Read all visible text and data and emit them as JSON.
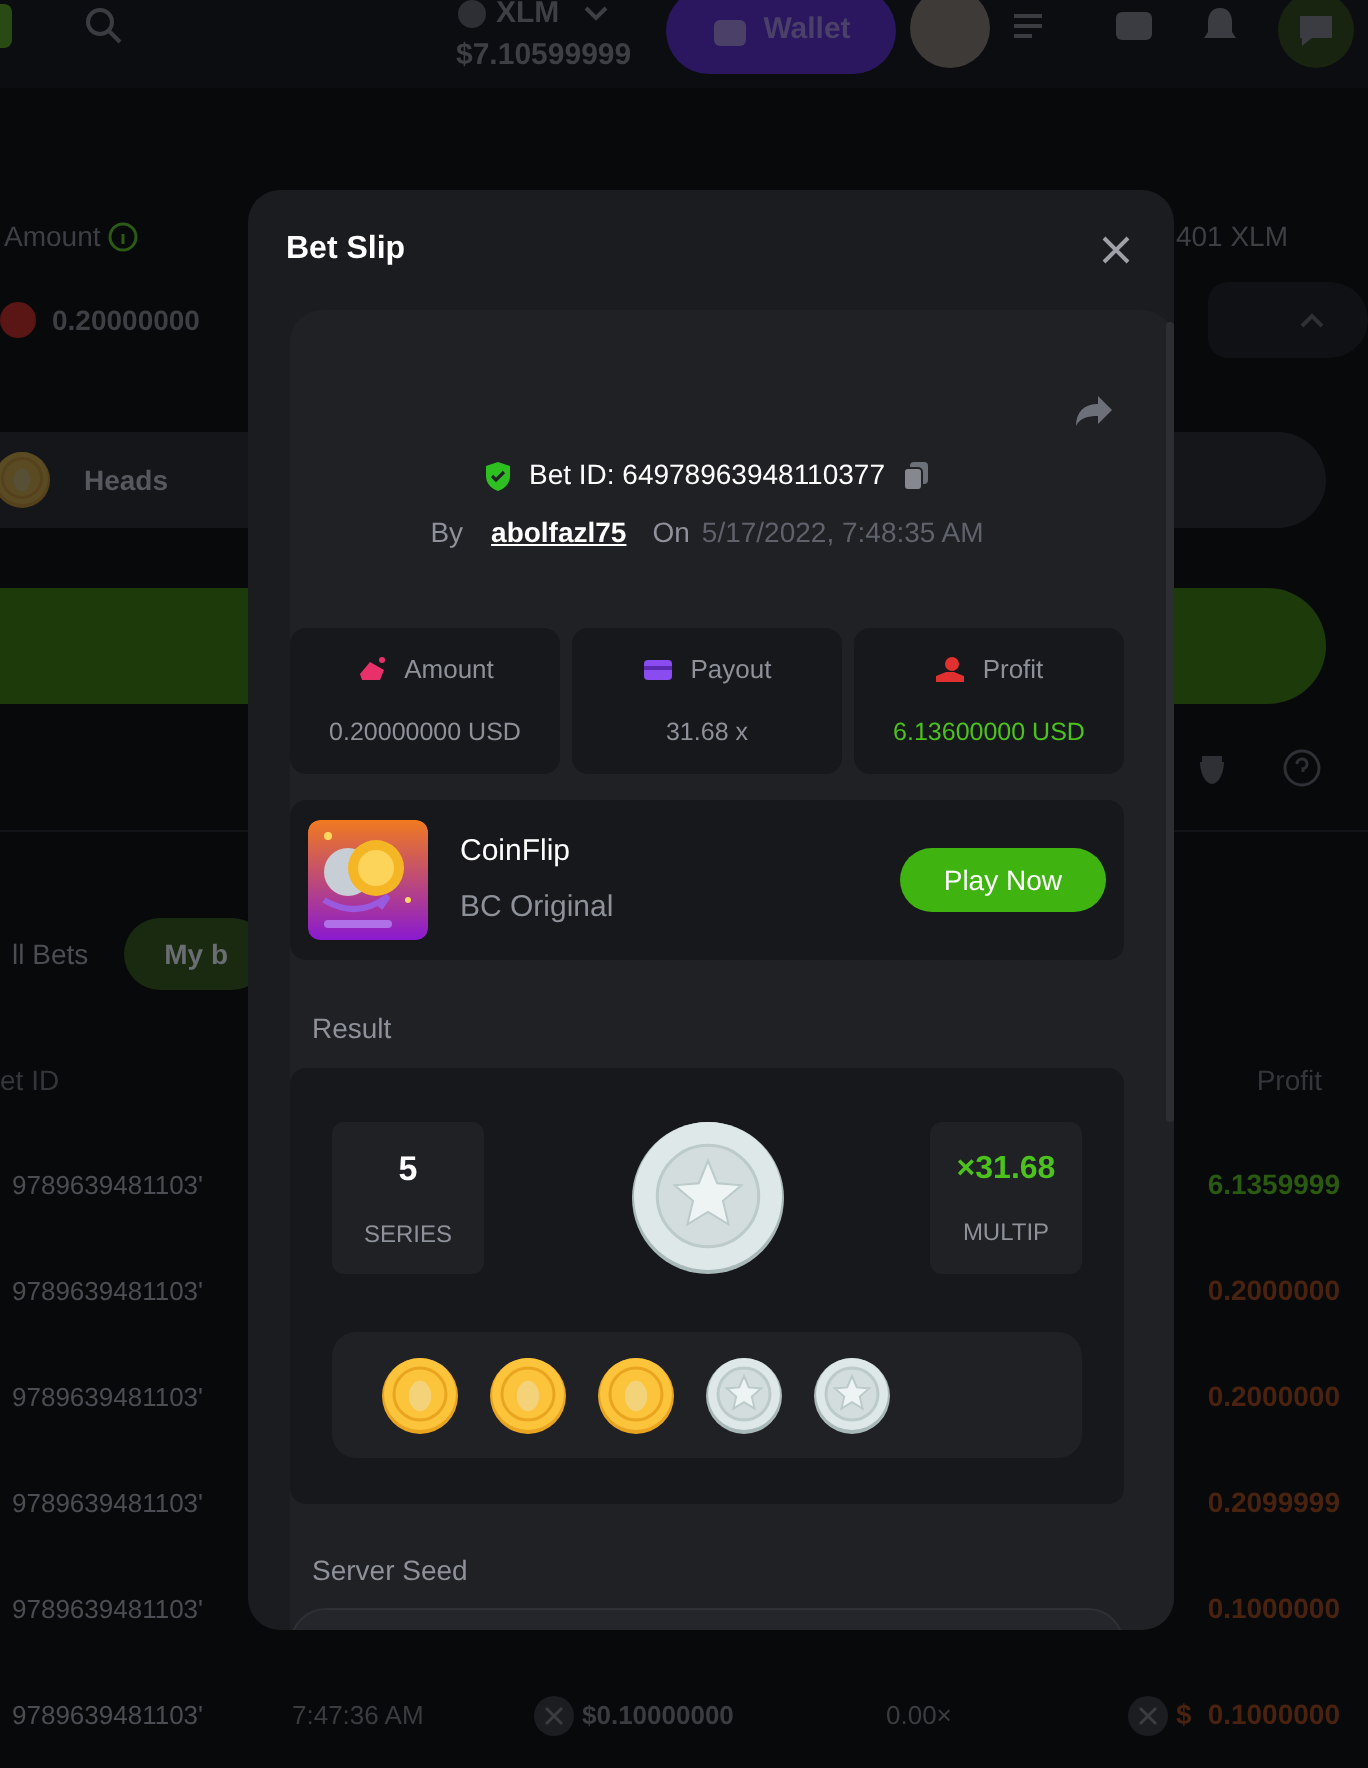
{
  "header": {
    "currency": "XLM",
    "balance": "$7.10599999",
    "wallet_button": "Wallet"
  },
  "bet_panel": {
    "amount_label": "Amount",
    "amount_value": "0.20000000",
    "max_label": "401 XLM",
    "side": "Heads"
  },
  "bets_tabs": [
    {
      "label": "ll Bets",
      "selected": false
    },
    {
      "label": "My b",
      "selected": true
    }
  ],
  "bets_table": {
    "columns": [
      "et ID",
      "Profit"
    ],
    "rows": [
      {
        "bet_id": "9789639481103'",
        "profit": "6.1359999",
        "won": true
      },
      {
        "bet_id": "9789639481103'",
        "profit": "0.2000000",
        "won": false
      },
      {
        "bet_id": "9789639481103'",
        "profit": "0.2000000",
        "won": false
      },
      {
        "bet_id": "9789639481103'",
        "profit": "0.2099999",
        "won": false
      },
      {
        "bet_id": "9789639481103'",
        "profit": "0.1000000",
        "won": false
      },
      {
        "bet_id": "9789639481103'",
        "time": "7:47:36 AM",
        "amount": "$0.10000000",
        "payout": "0.00×",
        "currency": "$",
        "profit": "0.1000000",
        "won": false
      }
    ]
  },
  "bet_slip": {
    "title": "Bet Slip",
    "bet_id": "Bet ID: 64978963948110377",
    "by_label": "By",
    "user": "abolfazl75",
    "on_label": "On",
    "date": "5/17/2022, 7:48:35 AM",
    "stats": [
      {
        "kind": "amount",
        "label": "Amount",
        "value": "0.20000000 USD"
      },
      {
        "kind": "payout",
        "label": "Payout",
        "value": "31.68 x"
      },
      {
        "kind": "profit",
        "label": "Profit",
        "value": "6.13600000 USD"
      }
    ],
    "game": {
      "name": "CoinFlip",
      "provider": "BC Original",
      "button": "Play Now"
    },
    "result": {
      "label": "Result",
      "series": "5",
      "series_label": "SERIES",
      "multiplier": "×31.68",
      "multiplier_label": "MULTIP",
      "outcome": {
        "kind": "tails"
      },
      "flips": [
        {
          "kind": "heads"
        },
        {
          "kind": "heads"
        },
        {
          "kind": "heads"
        },
        {
          "kind": "tails"
        },
        {
          "kind": "tails"
        }
      ]
    },
    "server_seed_label": "Server Seed"
  }
}
